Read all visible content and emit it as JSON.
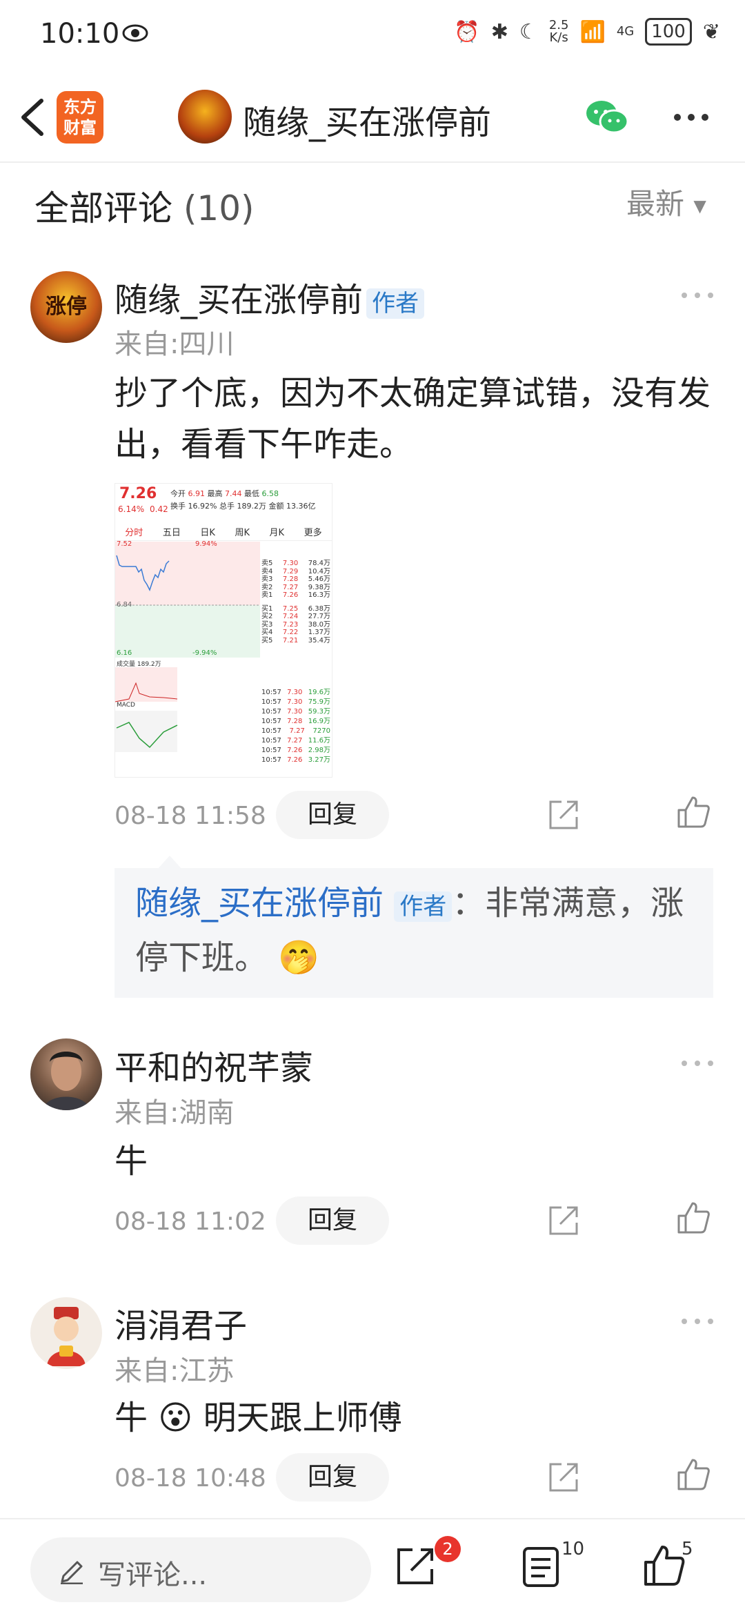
{
  "status_bar": {
    "time": "10:10",
    "speed_top": "2.5",
    "speed_bottom": "K/s",
    "net": "4G",
    "battery": "100"
  },
  "nav": {
    "app_logo_line1": "东方",
    "app_logo_line2": "财富",
    "title": "随缘_买在涨停前"
  },
  "header": {
    "title": "全部评论",
    "count": "(10)",
    "sort": "最新"
  },
  "comments": [
    {
      "name": "随缘_买在涨停前",
      "badge": "作者",
      "location": "来自:四川",
      "text": "抄了个底，因为不太确定算试错，没有发出，看看下午咋走。",
      "time": "08-18 11:58",
      "reply_label": "回复",
      "sub_reply": {
        "name": "随缘_买在涨停前",
        "badge": "作者",
        "text": "：非常满意，涨停下班。"
      },
      "chart": {
        "price": "7.26",
        "pct": "6.14%",
        "chg": "0.42",
        "open_label": "今开",
        "open": "6.91",
        "high_label": "最高",
        "high": "7.44",
        "low_label": "最低",
        "low": "6.58",
        "turnover_label": "换手",
        "turnover": "16.92%",
        "vol_label": "总手",
        "vol": "189.2万",
        "amt_label": "金额",
        "amt": "13.36亿",
        "tabs": [
          "分时",
          "五日",
          "日K",
          "周K",
          "月K",
          "更多"
        ],
        "top_price": "7.52",
        "mid_price": "6.84",
        "bottom_price": "6.16",
        "top_pct": "9.94%",
        "bottom_pct": "-9.94%",
        "book": [
          {
            "l": "卖5",
            "p": "7.30",
            "v": "78.4万"
          },
          {
            "l": "卖4",
            "p": "7.29",
            "v": "10.4万"
          },
          {
            "l": "卖3",
            "p": "7.28",
            "v": "5.46万"
          },
          {
            "l": "卖2",
            "p": "7.27",
            "v": "9.38万"
          },
          {
            "l": "卖1",
            "p": "7.26",
            "v": "16.3万"
          },
          {
            "l": "买1",
            "p": "7.25",
            "v": "6.38万"
          },
          {
            "l": "买2",
            "p": "7.24",
            "v": "27.7万"
          },
          {
            "l": "买3",
            "p": "7.23",
            "v": "38.0万"
          },
          {
            "l": "买4",
            "p": "7.22",
            "v": "1.37万"
          },
          {
            "l": "买5",
            "p": "7.21",
            "v": "35.4万"
          }
        ],
        "ticks": [
          {
            "t": "10:57",
            "p": "7.30",
            "v": "19.6万"
          },
          {
            "t": "10:57",
            "p": "7.30",
            "v": "75.9万"
          },
          {
            "t": "10:57",
            "p": "7.30",
            "v": "59.3万"
          },
          {
            "t": "10:57",
            "p": "7.28",
            "v": "16.9万"
          },
          {
            "t": "10:57",
            "p": "7.27",
            "v": "7270"
          },
          {
            "t": "10:57",
            "p": "7.27",
            "v": "11.6万"
          },
          {
            "t": "10:57",
            "p": "7.26",
            "v": "2.98万"
          },
          {
            "t": "10:57",
            "p": "7.26",
            "v": "3.27万"
          }
        ],
        "vol_row": "成交量 189.2万",
        "macd_label": "MACD"
      }
    },
    {
      "name": "平和的祝芊蒙",
      "location": "来自:湖南",
      "text": "牛",
      "time": "08-18 11:02",
      "reply_label": "回复"
    },
    {
      "name": "涓涓君子",
      "location": "来自:江苏",
      "text_before": "牛",
      "text_after": "明天跟上师傅",
      "time": "08-18 10:48",
      "reply_label": "回复"
    }
  ],
  "bottom_bar": {
    "placeholder": "写评论...",
    "share_badge": "2",
    "comment_count": "10",
    "like_count": "5"
  },
  "colors": {
    "accent_blue": "#2b6ec7",
    "red_badge": "#e8342c",
    "app_orange": "#f26422"
  }
}
